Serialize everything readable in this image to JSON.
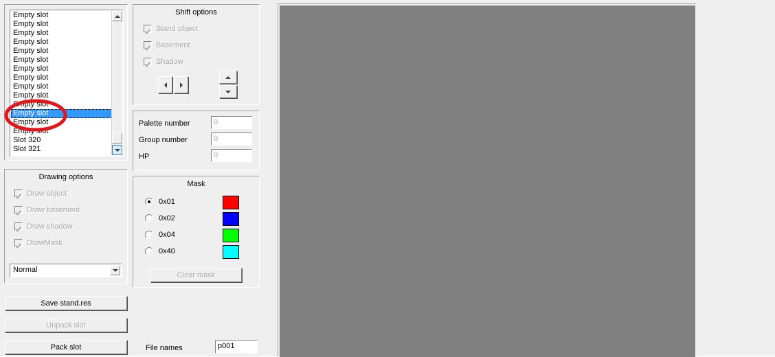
{
  "slot_list": {
    "name": "slot-list",
    "items": [
      {
        "label": "Empty slot",
        "selected": false
      },
      {
        "label": "Empty slot",
        "selected": false
      },
      {
        "label": "Empty slot",
        "selected": false
      },
      {
        "label": "Empty slot",
        "selected": false
      },
      {
        "label": "Empty slot",
        "selected": false
      },
      {
        "label": "Empty slot",
        "selected": false
      },
      {
        "label": "Empty slot",
        "selected": false
      },
      {
        "label": "Empty slot",
        "selected": false
      },
      {
        "label": "Empty slot",
        "selected": false
      },
      {
        "label": "Empty slot",
        "selected": false
      },
      {
        "label": "Empty slot",
        "selected": false
      },
      {
        "label": "Empty slot",
        "selected": true
      },
      {
        "label": "Empty slot",
        "selected": false
      },
      {
        "label": "Empty slot",
        "selected": false
      },
      {
        "label": "Slot 320",
        "selected": false
      },
      {
        "label": "Slot 321",
        "selected": false
      }
    ],
    "selected_index": 11,
    "selection_bg": "#3399ff",
    "selection_fg": "#ffffff"
  },
  "annotation": {
    "shape": "ellipse",
    "color": "#e3171b"
  },
  "shift_options": {
    "title": "Shift options",
    "checkboxes": [
      {
        "label": "Stand object",
        "checked": true,
        "enabled": false
      },
      {
        "label": "Basement",
        "checked": true,
        "enabled": false
      },
      {
        "label": "Shadow",
        "checked": true,
        "enabled": false
      }
    ],
    "buttons": [
      {
        "icon": "arrow-left-icon",
        "name": "shift-left-button"
      },
      {
        "icon": "arrow-right-icon",
        "name": "shift-right-button"
      },
      {
        "icon": "arrow-up-icon",
        "name": "shift-up-button"
      },
      {
        "icon": "arrow-down-icon",
        "name": "shift-down-button"
      }
    ]
  },
  "properties": {
    "fields": [
      {
        "label": "Palette number",
        "value": "0",
        "enabled": false
      },
      {
        "label": "Group number",
        "value": "0",
        "enabled": false
      },
      {
        "label": "HP",
        "value": "0",
        "enabled": false
      }
    ]
  },
  "mask": {
    "title": "Mask",
    "options": [
      {
        "label": "0x01",
        "color": "#ff0000",
        "selected": true
      },
      {
        "label": "0x02",
        "color": "#0000ff",
        "selected": false
      },
      {
        "label": "0x04",
        "color": "#00ff00",
        "selected": false
      },
      {
        "label": "0x40",
        "color": "#00ffff",
        "selected": false
      }
    ],
    "clear_button": {
      "label": "Clear mask",
      "enabled": false
    }
  },
  "drawing_options": {
    "title": "Drawing options",
    "checkboxes": [
      {
        "label": "Draw object",
        "checked": true,
        "enabled": false
      },
      {
        "label": "Draw basement",
        "checked": true,
        "enabled": false
      },
      {
        "label": "Draw shadow",
        "checked": true,
        "enabled": false
      },
      {
        "label": "DrawMask",
        "checked": true,
        "enabled": false
      }
    ],
    "mode_combo": {
      "value": "Normal"
    }
  },
  "actions": [
    {
      "label": "Save stand.res",
      "enabled": true
    },
    {
      "label": "Unpack slot",
      "enabled": false
    },
    {
      "label": "Pack slot",
      "enabled": true
    }
  ],
  "file_names": {
    "label": "File names",
    "value": "p001"
  },
  "canvas": {
    "background": "#808080"
  }
}
